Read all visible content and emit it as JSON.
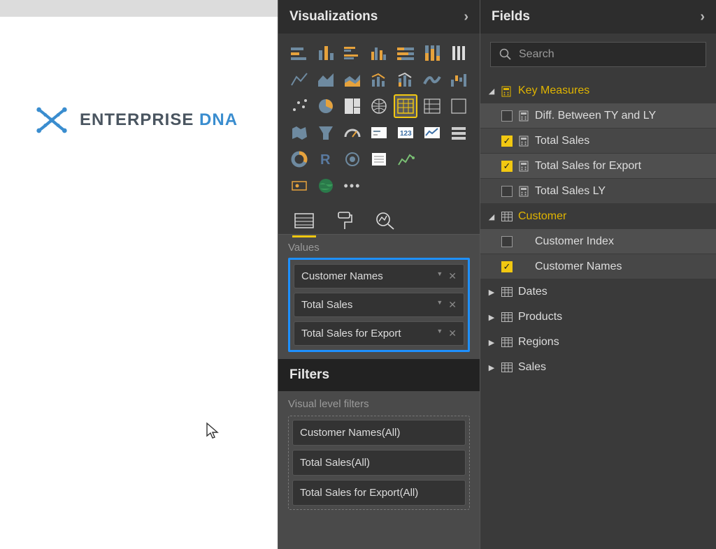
{
  "canvas": {
    "logo_main": "ENTERPRISE ",
    "logo_accent": "DNA"
  },
  "visualizations": {
    "title": "Visualizations",
    "values_label": "Values",
    "value_items": [
      {
        "label": "Customer Names"
      },
      {
        "label": "Total Sales"
      },
      {
        "label": "Total Sales for Export"
      }
    ],
    "filters_title": "Filters",
    "visual_filters_label": "Visual level filters",
    "filter_items": [
      {
        "label": "Customer Names(All)"
      },
      {
        "label": "Total Sales(All)"
      },
      {
        "label": "Total Sales for Export(All)"
      }
    ]
  },
  "fields": {
    "title": "Fields",
    "search_placeholder": "Search",
    "groups": [
      {
        "name": "Key Measures",
        "expanded": true,
        "icon": "calc",
        "items": [
          {
            "label": "Diff. Between TY and LY",
            "checked": false,
            "type": "calc"
          },
          {
            "label": "Total Sales",
            "checked": true,
            "type": "calc"
          },
          {
            "label": "Total Sales for Export",
            "checked": true,
            "type": "calc"
          },
          {
            "label": "Total Sales LY",
            "checked": false,
            "type": "calc"
          }
        ]
      },
      {
        "name": "Customer",
        "expanded": true,
        "icon": "table",
        "items": [
          {
            "label": "Customer Index",
            "checked": false,
            "type": "col"
          },
          {
            "label": "Customer Names",
            "checked": true,
            "type": "col"
          }
        ]
      },
      {
        "name": "Dates",
        "expanded": false,
        "icon": "table",
        "items": []
      },
      {
        "name": "Products",
        "expanded": false,
        "icon": "table",
        "items": []
      },
      {
        "name": "Regions",
        "expanded": false,
        "icon": "table",
        "items": []
      },
      {
        "name": "Sales",
        "expanded": false,
        "icon": "table",
        "items": []
      }
    ]
  }
}
